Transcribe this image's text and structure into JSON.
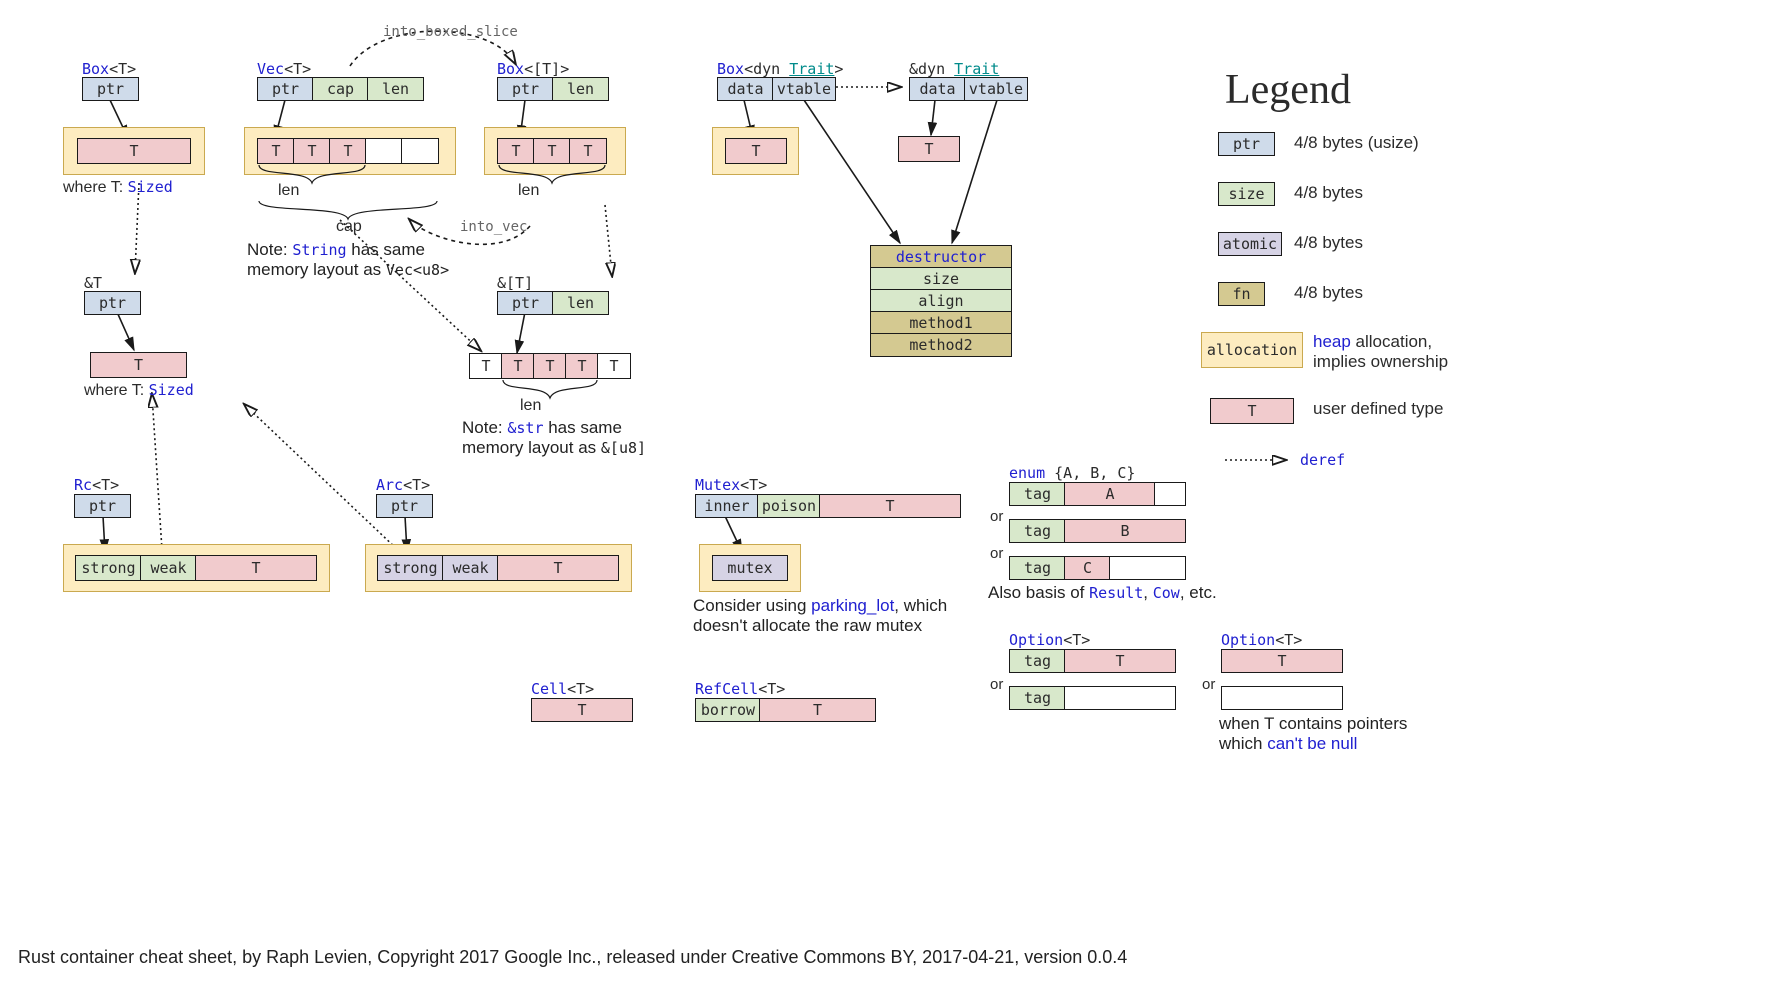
{
  "boxT": {
    "title_1": "Box",
    "title_2": "<T>",
    "ptr": "ptr",
    "T": "T",
    "where": "where T: ",
    "sized": "Sized"
  },
  "refT": {
    "title": "&T",
    "ptr": "ptr",
    "T": "T",
    "where": "where T: ",
    "sized": "Sized"
  },
  "vecT": {
    "title_1": "Vec",
    "title_2": "<T>",
    "ptr": "ptr",
    "cap": "cap",
    "len": "len",
    "T": "T",
    "lenlbl": "len",
    "caplbl": "cap",
    "note1": "Note: ",
    "string": "String",
    "note2": " has same",
    "note3": "memory layout as ",
    "vecu8": "Vec<u8>"
  },
  "into_boxed": "into_boxed_slice",
  "into_vec": "into_vec",
  "boxSlice": {
    "title_1": "Box",
    "title_2": "<[T]>",
    "ptr": "ptr",
    "len": "len",
    "T": "T",
    "lenlbl": "len"
  },
  "sliceT": {
    "title": "&[T]",
    "ptr": "ptr",
    "len": "len",
    "T": "T",
    "lenlbl": "len",
    "note1": "Note: ",
    "str": "&str",
    "note2": " has same",
    "note3": "memory layout as ",
    "ru8": "&[u8]"
  },
  "boxDyn": {
    "title_1": "Box",
    "title_2": "<dyn ",
    "trait": "Trait",
    "title_3": ">",
    "data": "data",
    "vtable": "vtable",
    "T": "T"
  },
  "refDyn": {
    "title_1": "&dyn ",
    "trait": "Trait",
    "data": "data",
    "vtable": "vtable",
    "T": "T"
  },
  "vtable": {
    "destructor": "destructor",
    "size": "size",
    "align": "align",
    "m1": "method1",
    "m2": "method2"
  },
  "rc": {
    "title_1": "Rc",
    "title_2": "<T>",
    "ptr": "ptr",
    "strong": "strong",
    "weak": "weak",
    "T": "T"
  },
  "arc": {
    "title_1": "Arc",
    "title_2": "<T>",
    "ptr": "ptr",
    "strong": "strong",
    "weak": "weak",
    "T": "T"
  },
  "mutex": {
    "title_1": "Mutex",
    "title_2": "<T>",
    "inner": "inner",
    "poison": "poison",
    "T": "T",
    "mutex": "mutex",
    "note1": "Consider using ",
    "parking": "parking_lot",
    "note2": ", which",
    "note3": "doesn't allocate the raw mutex"
  },
  "enum": {
    "title_1": "enum",
    "title_2": " {A, B, C}",
    "tag": "tag",
    "A": "A",
    "B": "B",
    "C": "C",
    "or": "or",
    "note1": "Also basis of ",
    "result": "Result",
    "comma": ", ",
    "cow": "Cow",
    "etc": ", etc."
  },
  "optL": {
    "title_1": "Option",
    "title_2": "<T>",
    "tag": "tag",
    "T": "T",
    "or": "or"
  },
  "optR": {
    "title_1": "Option",
    "title_2": "<T>",
    "T": "T",
    "or": "or",
    "note1": "when T contains pointers",
    "note2": "which ",
    "link": "can't be null"
  },
  "cell": {
    "title_1": "Cell",
    "title_2": "<T>",
    "T": "T"
  },
  "refcell": {
    "title_1": "RefCell",
    "title_2": "<T>",
    "borrow": "borrow",
    "T": "T"
  },
  "legend": {
    "title": "Legend",
    "ptr": "ptr",
    "ptrd": "4/8 bytes (usize)",
    "size": "size",
    "sized": "4/8 bytes",
    "atomic": "atomic",
    "atomicd": "4/8 bytes",
    "fn": "fn",
    "fnd": "4/8 bytes",
    "alloc": "allocation",
    "allocd1": "heap",
    "allocd2": " allocation,",
    "allocd3": "implies ownership",
    "T": "T",
    "Td": "user defined type",
    "deref": "deref"
  },
  "footer": "Rust container cheat sheet, by Raph Levien, Copyright 2017 Google Inc., released under Creative Commons BY, 2017-04-21, version 0.0.4"
}
